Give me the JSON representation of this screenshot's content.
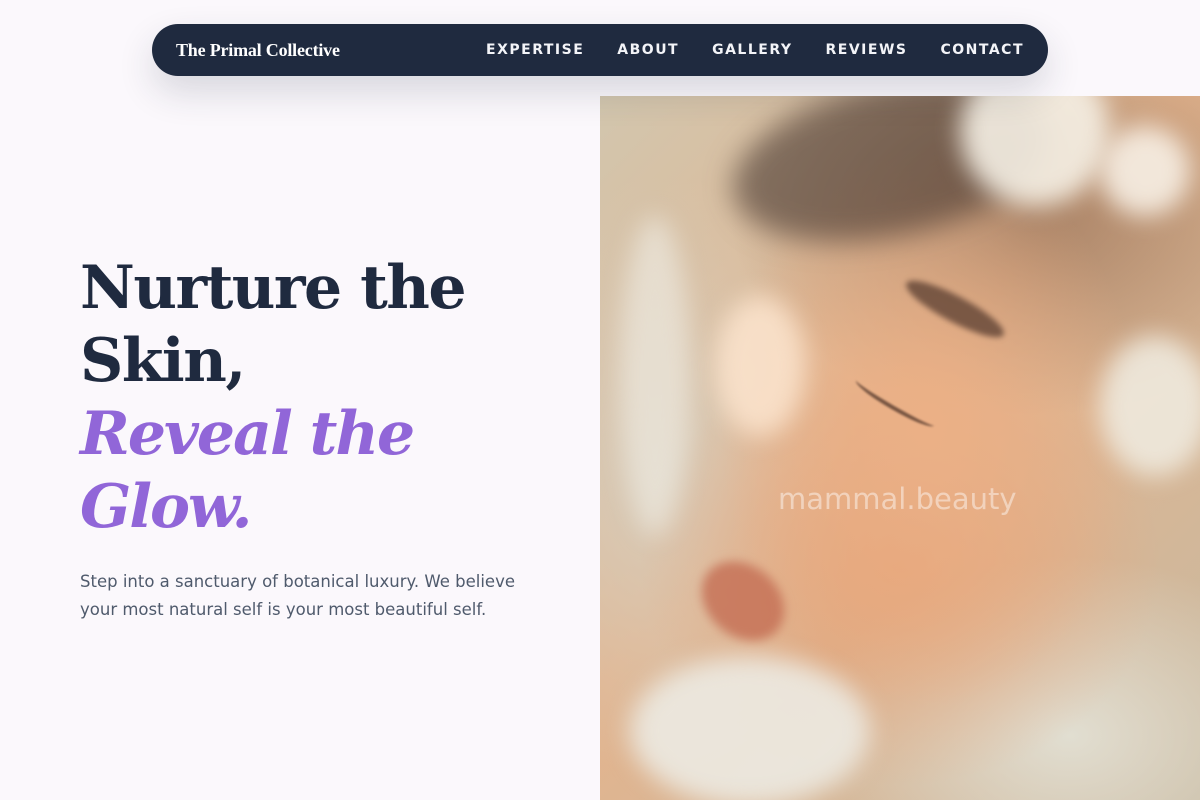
{
  "navbar": {
    "brand": "The Primal Collective",
    "links": [
      "EXPERTISE",
      "ABOUT",
      "GALLERY",
      "REVIEWS",
      "CONTACT"
    ]
  },
  "hero": {
    "title_line1": "Nurture the",
    "title_line2": "Skin,",
    "title_accent_line1": "Reveal the",
    "title_accent_line2": "Glow.",
    "subtitle": "Step into a sanctuary of botanical luxury. We believe your most natural self is your most beautiful self.",
    "image_watermark": "mammal.beauty"
  },
  "colors": {
    "navy": "#1f2a3f",
    "accent_purple": "#9166d8",
    "background": "#fbf8fc",
    "body_text": "#4f5a6c"
  }
}
